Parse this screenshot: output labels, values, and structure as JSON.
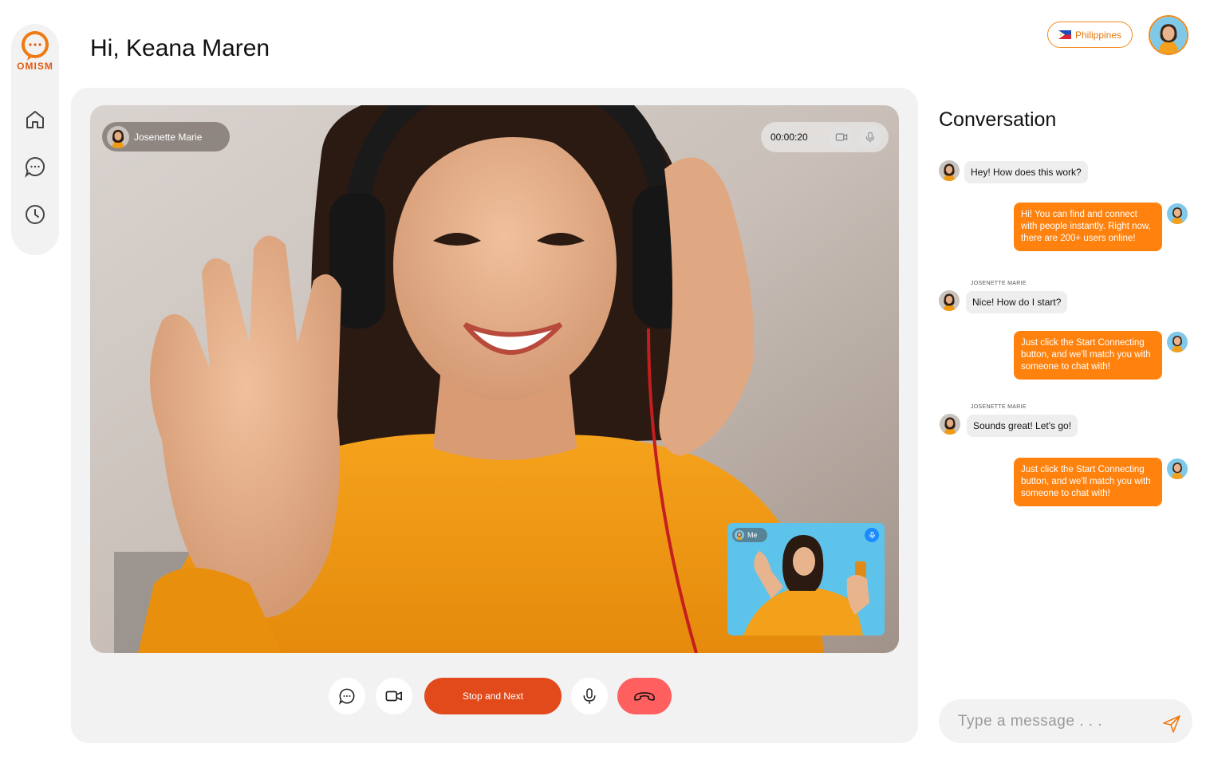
{
  "app": {
    "logo_text": "OMISM"
  },
  "header": {
    "greeting": "Hi, Keana Maren",
    "country": "Philippines"
  },
  "sidebar": {
    "items": [
      {
        "name": "home",
        "icon": "home-icon"
      },
      {
        "name": "chats",
        "icon": "chat-bubble-icon"
      },
      {
        "name": "history",
        "icon": "clock-icon"
      }
    ]
  },
  "call": {
    "peer_name": "Josenette Marie",
    "timer": "00:00:20",
    "self_label": "Me",
    "stop_next_label": "Stop and Next"
  },
  "conversation": {
    "title": "Conversation",
    "messages": [
      {
        "from": "peer",
        "text": "Hey! How does this work?"
      },
      {
        "from": "me",
        "text": "Hi! You can find and connect with people instantly. Right now, there are 200+ users online!"
      },
      {
        "from": "peer",
        "sender": "JOSENETTE MARIE",
        "text": "Nice! How do I start?"
      },
      {
        "from": "me",
        "text": "Just click the Start Connecting button, and we'll match you with someone to chat with!"
      },
      {
        "from": "peer",
        "sender": "JOSENETTE MARIE",
        "text": "Sounds great! Let's go!"
      },
      {
        "from": "me",
        "text": "Just click the Start Connecting button, and we'll match you with someone to chat with!"
      }
    ],
    "composer_placeholder": "Type a message . . ."
  },
  "colors": {
    "accent": "#ff820e",
    "stop_button": "#e24a1c",
    "end_call": "#ff5f5f",
    "panel": "#f2f2f2"
  }
}
